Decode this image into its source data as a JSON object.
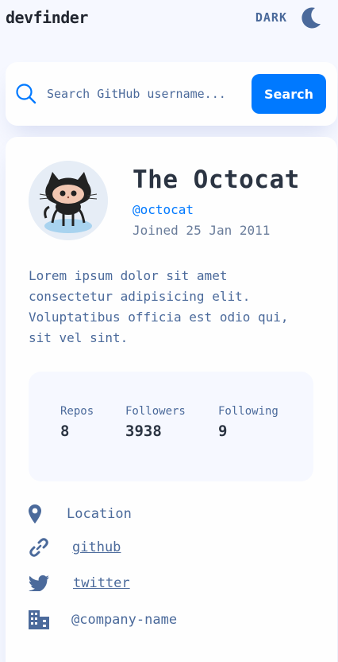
{
  "header": {
    "logo": "devfinder",
    "theme_label": "DARK",
    "theme_icon": "moon-icon"
  },
  "search": {
    "placeholder": "Search GitHub username...",
    "value": "",
    "button_label": "Search",
    "icon": "search-icon"
  },
  "profile": {
    "name": "The Octocat",
    "login": "@octocat",
    "joined": "Joined 25 Jan 2011",
    "bio": "Lorem ipsum dolor sit amet consectetur adipisicing elit. Voluptatibus officia est odio qui, sit vel sint.",
    "avatar": "octocat-avatar"
  },
  "stats": [
    {
      "label": "Repos",
      "value": "8"
    },
    {
      "label": "Followers",
      "value": "3938"
    },
    {
      "label": "Following",
      "value": "9"
    }
  ],
  "links": {
    "location": {
      "icon": "location-pin-icon",
      "text": "Location"
    },
    "blog": {
      "icon": "link-icon",
      "text": "github"
    },
    "twitter": {
      "icon": "twitter-icon",
      "text": "twitter"
    },
    "company": {
      "icon": "building-icon",
      "text": "@company-name"
    }
  },
  "colors": {
    "accent": "#0079ff",
    "background": "#f6f8ff",
    "card": "#fefefe",
    "text_primary": "#2b3442",
    "text_secondary": "#4b6a9b"
  }
}
